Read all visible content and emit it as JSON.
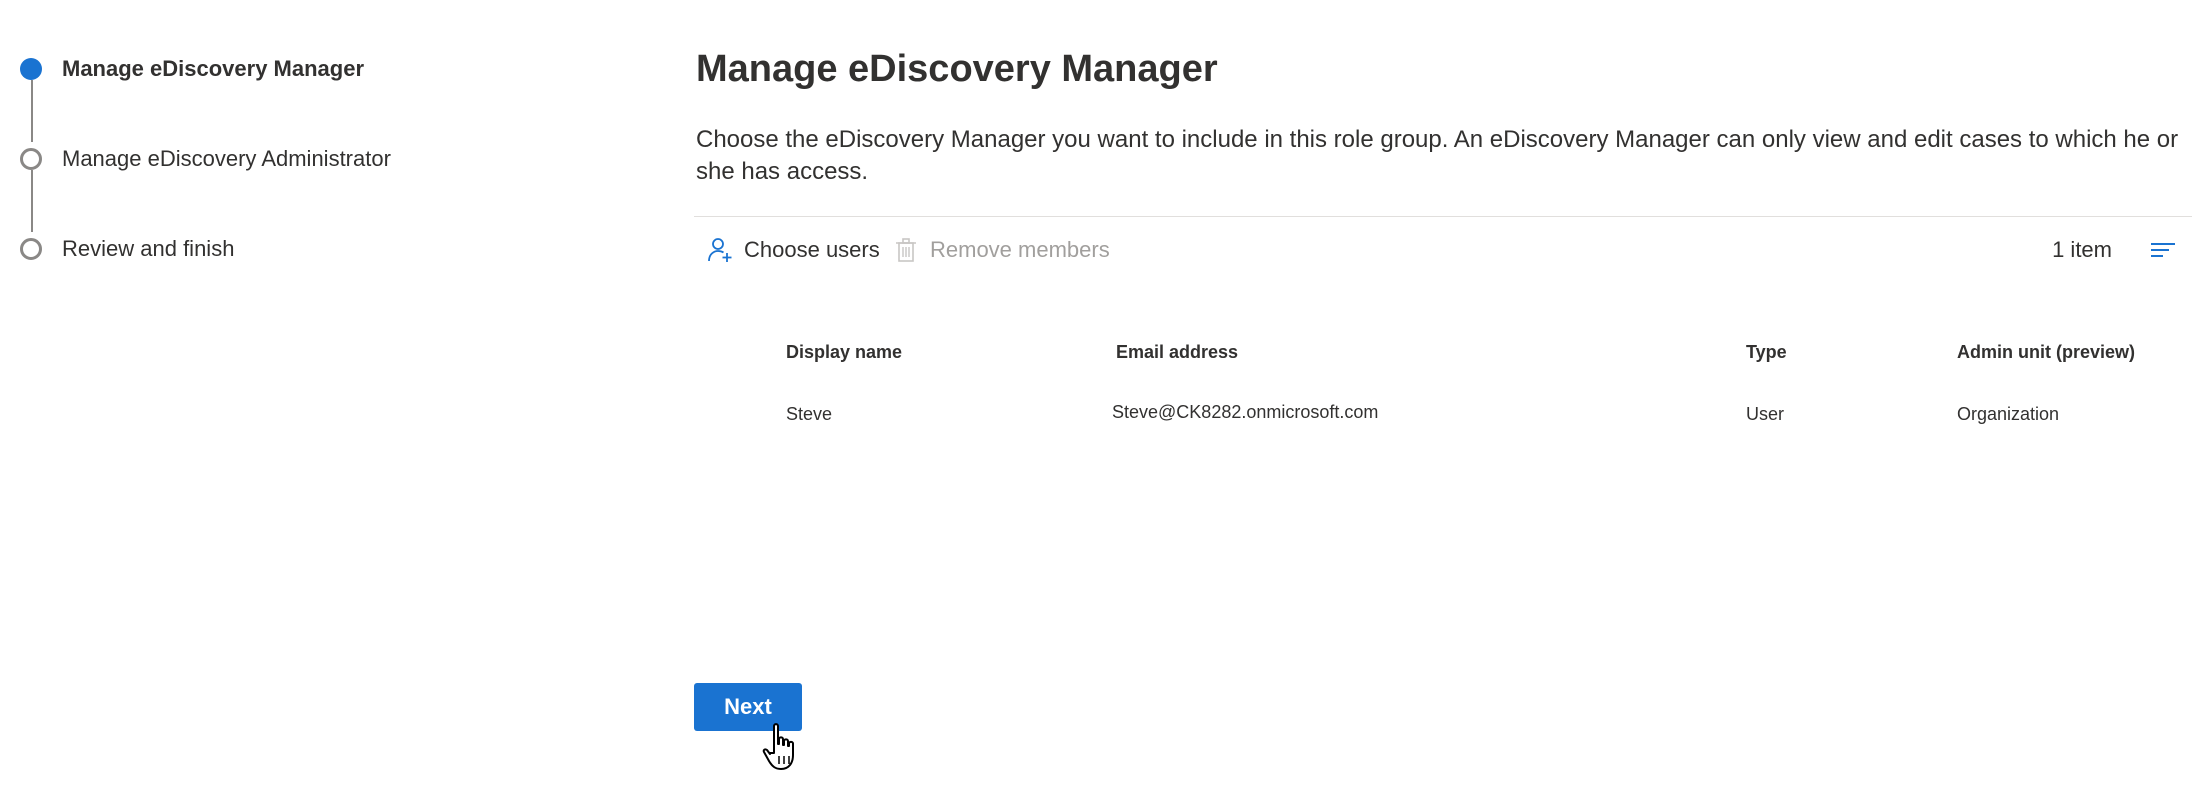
{
  "stepper": {
    "steps": [
      {
        "label": "Manage eDiscovery Manager",
        "state": "current"
      },
      {
        "label": "Manage eDiscovery Administrator",
        "state": "upcoming"
      },
      {
        "label": "Review and finish",
        "state": "upcoming"
      }
    ]
  },
  "main": {
    "title": "Manage eDiscovery Manager",
    "description": "Choose the eDiscovery Manager you want to include in this role group. An eDiscovery Manager can only view and edit cases to which he or she has access.",
    "command_bar": {
      "choose_users_label": "Choose users",
      "choose_users_icon": "add-person-icon",
      "remove_members_label": "Remove members",
      "remove_members_icon": "trash-icon",
      "remove_members_enabled": false,
      "item_count": "1 item",
      "filter_icon": "filter-lines-icon"
    },
    "table": {
      "columns": [
        "Display name",
        "Email address",
        "Type",
        "Admin unit (preview)"
      ],
      "rows": [
        {
          "display_name": "Steve",
          "email": "Steve@CK8282.onmicrosoft.com",
          "type": "User",
          "admin_unit": "Organization"
        }
      ]
    }
  },
  "footer": {
    "next_label": "Next"
  },
  "colors": {
    "accent": "#1a73d1",
    "text": "#323130",
    "disabled_text": "#a19f9d",
    "step_outline": "#8a8886"
  }
}
